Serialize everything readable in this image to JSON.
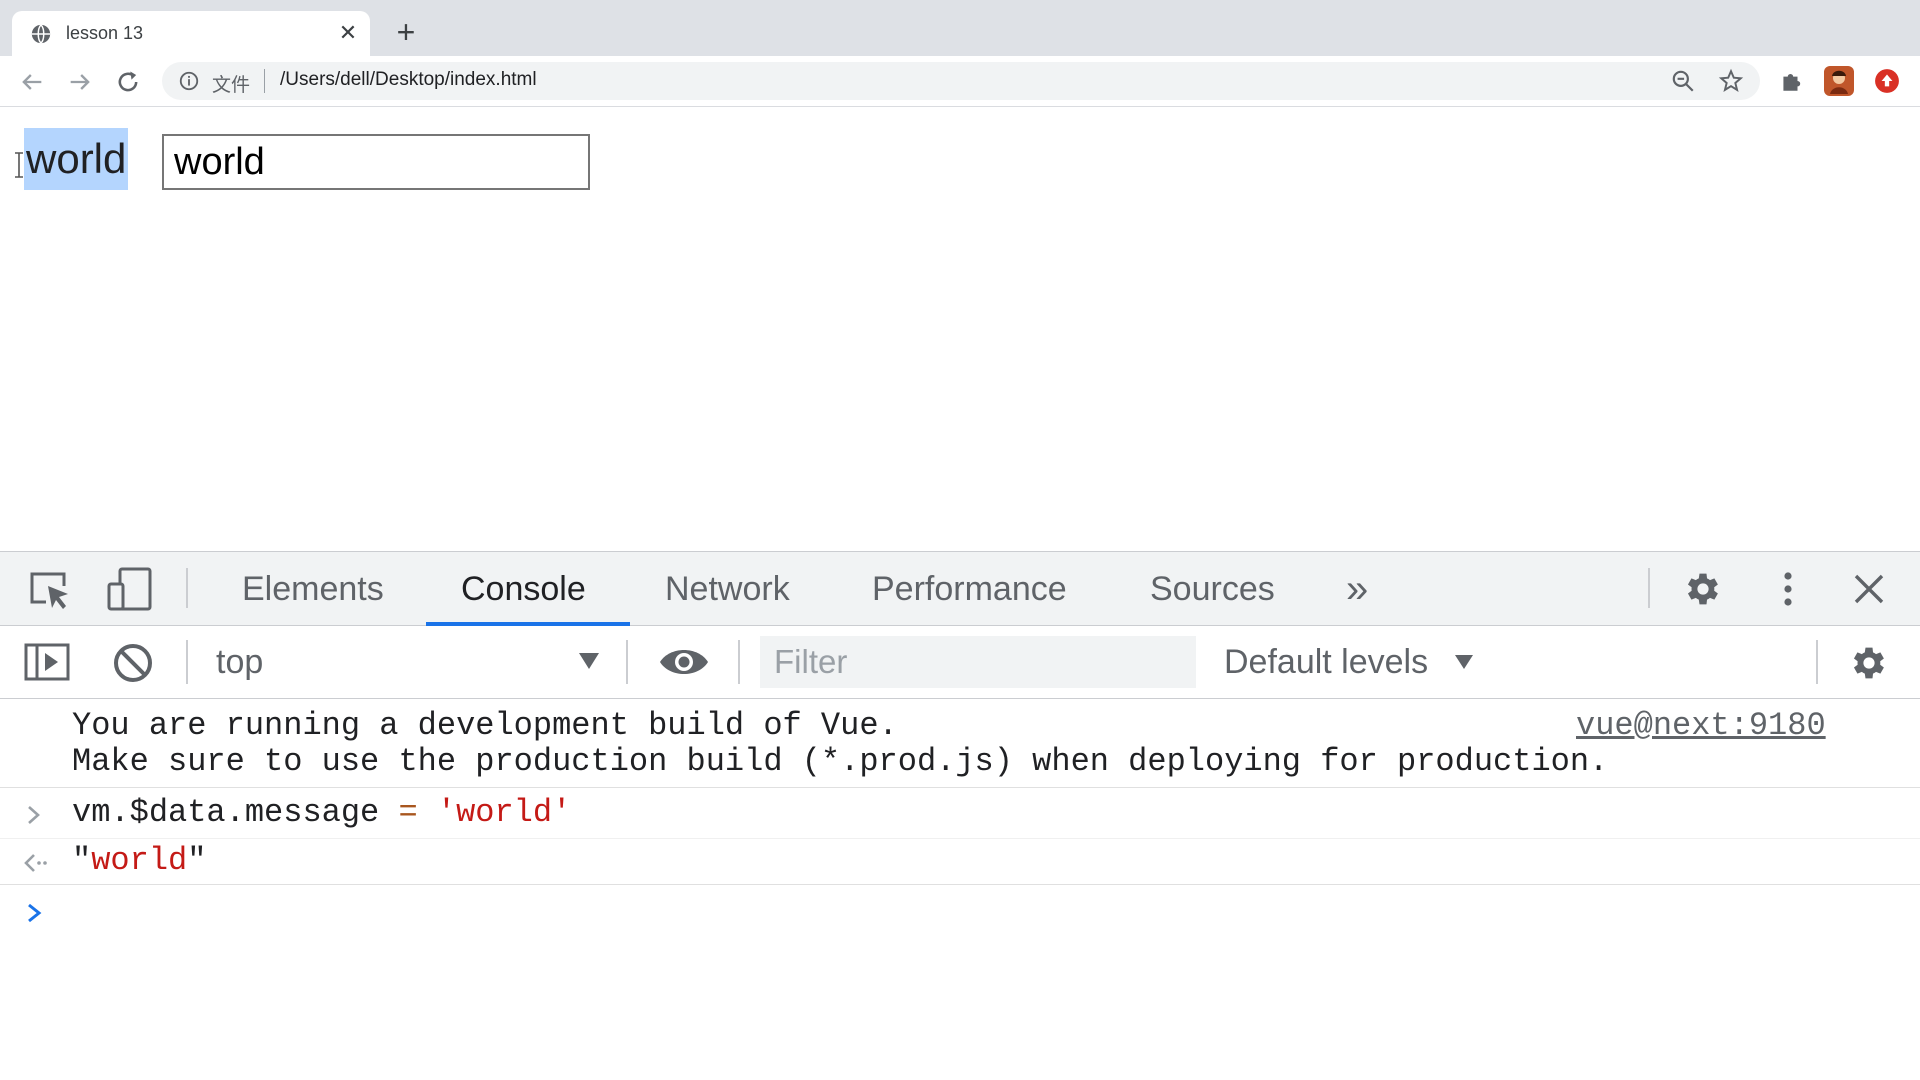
{
  "browser": {
    "tab_title": "lesson 13",
    "new_tab_symbol": "+",
    "close_symbol": "✕",
    "url_scheme_label": "文件",
    "url": "/Users/dell/Desktop/index.html",
    "icons": [
      "globe-icon",
      "back-icon",
      "forward-icon",
      "reload-icon",
      "info-icon",
      "zoom-icon",
      "star-icon",
      "extensions-icon",
      "avatar",
      "update-icon"
    ]
  },
  "page": {
    "text": "world",
    "input_value": "world"
  },
  "devtools": {
    "tabs": [
      "Elements",
      "Console",
      "Network",
      "Performance",
      "Sources"
    ],
    "more_tabs": "»",
    "active_tab": "Console",
    "context": "top",
    "filter_placeholder": "Filter",
    "levels": "Default levels"
  },
  "console": {
    "vue_line1": "You are running a development build of Vue.",
    "vue_line2": "Make sure to use the production build (*.prod.js) when deploying for production.",
    "vue_link": "vue@next:9180",
    "input_lhs": "vm.$data.message",
    "input_op": "=",
    "input_rhs": "'world'",
    "result_quote_open": "\"",
    "result_value": "world",
    "result_quote_close": "\""
  },
  "colors": {
    "accent": "#1a73e8",
    "string": "#c41a16",
    "selection": "#b4d5fe"
  }
}
